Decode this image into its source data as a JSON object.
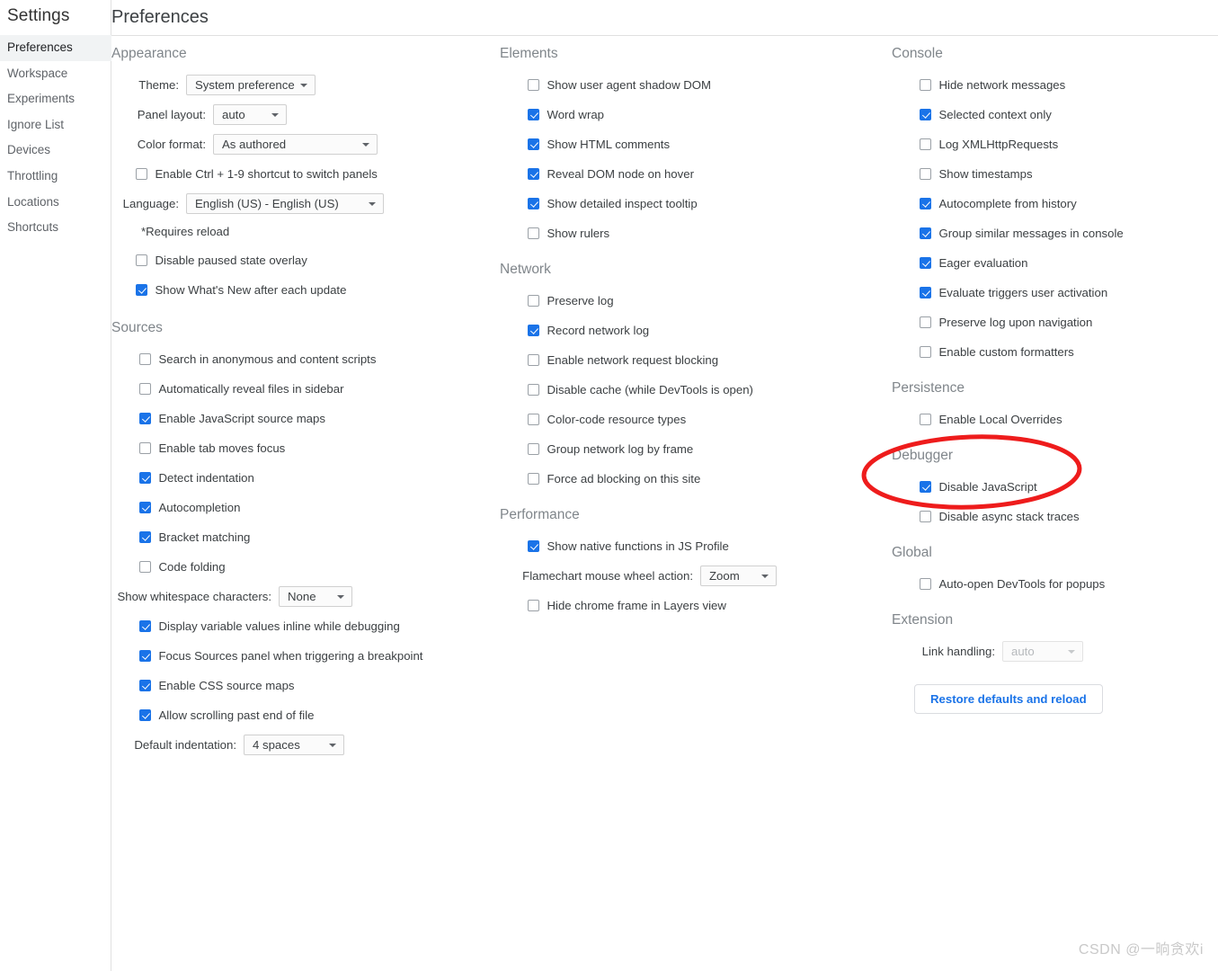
{
  "sidebar": {
    "title": "Settings",
    "items": [
      {
        "label": "Preferences",
        "selected": true
      },
      {
        "label": "Workspace",
        "selected": false
      },
      {
        "label": "Experiments",
        "selected": false
      },
      {
        "label": "Ignore List",
        "selected": false
      },
      {
        "label": "Devices",
        "selected": false
      },
      {
        "label": "Throttling",
        "selected": false
      },
      {
        "label": "Locations",
        "selected": false
      },
      {
        "label": "Shortcuts",
        "selected": false
      }
    ]
  },
  "header": {
    "title": "Preferences"
  },
  "sections": {
    "appearance": {
      "title": "Appearance",
      "theme_label": "Theme:",
      "theme_value": "System preference",
      "panel_layout_label": "Panel layout:",
      "panel_layout_value": "auto",
      "color_format_label": "Color format:",
      "color_format_value": "As authored",
      "ctrl_shortcut_label": "Enable Ctrl + 1-9 shortcut to switch panels",
      "ctrl_shortcut_checked": false,
      "language_label": "Language:",
      "language_value": "English (US) - English (US)",
      "requires_reload_note": "*Requires reload",
      "disable_paused_overlay_label": "Disable paused state overlay",
      "disable_paused_overlay_checked": false,
      "whats_new_label": "Show What's New after each update",
      "whats_new_checked": true
    },
    "sources": {
      "title": "Sources",
      "items": [
        {
          "label": "Search in anonymous and content scripts",
          "checked": false
        },
        {
          "label": "Automatically reveal files in sidebar",
          "checked": false
        },
        {
          "label": "Enable JavaScript source maps",
          "checked": true
        },
        {
          "label": "Enable tab moves focus",
          "checked": false
        },
        {
          "label": "Detect indentation",
          "checked": true
        },
        {
          "label": "Autocompletion",
          "checked": true
        },
        {
          "label": "Bracket matching",
          "checked": true
        },
        {
          "label": "Code folding",
          "checked": false
        }
      ],
      "whitespace_label": "Show whitespace characters:",
      "whitespace_value": "None",
      "items2": [
        {
          "label": "Display variable values inline while debugging",
          "checked": true
        },
        {
          "label": "Focus Sources panel when triggering a breakpoint",
          "checked": true
        },
        {
          "label": "Enable CSS source maps",
          "checked": true
        },
        {
          "label": "Allow scrolling past end of file",
          "checked": true
        }
      ],
      "indentation_label": "Default indentation:",
      "indentation_value": "4 spaces"
    },
    "elements": {
      "title": "Elements",
      "items": [
        {
          "label": "Show user agent shadow DOM",
          "checked": false
        },
        {
          "label": "Word wrap",
          "checked": true
        },
        {
          "label": "Show HTML comments",
          "checked": true
        },
        {
          "label": "Reveal DOM node on hover",
          "checked": true
        },
        {
          "label": "Show detailed inspect tooltip",
          "checked": true
        },
        {
          "label": "Show rulers",
          "checked": false
        }
      ]
    },
    "network": {
      "title": "Network",
      "items": [
        {
          "label": "Preserve log",
          "checked": false
        },
        {
          "label": "Record network log",
          "checked": true
        },
        {
          "label": "Enable network request blocking",
          "checked": false
        },
        {
          "label": "Disable cache (while DevTools is open)",
          "checked": false
        },
        {
          "label": "Color-code resource types",
          "checked": false
        },
        {
          "label": "Group network log by frame",
          "checked": false
        },
        {
          "label": "Force ad blocking on this site",
          "checked": false
        }
      ]
    },
    "performance": {
      "title": "Performance",
      "native_functions_label": "Show native functions in JS Profile",
      "native_functions_checked": true,
      "flamechart_label": "Flamechart mouse wheel action:",
      "flamechart_value": "Zoom",
      "hide_chrome_frame_label": "Hide chrome frame in Layers view",
      "hide_chrome_frame_checked": false
    },
    "console": {
      "title": "Console",
      "items": [
        {
          "label": "Hide network messages",
          "checked": false
        },
        {
          "label": "Selected context only",
          "checked": true
        },
        {
          "label": "Log XMLHttpRequests",
          "checked": false
        },
        {
          "label": "Show timestamps",
          "checked": false
        },
        {
          "label": "Autocomplete from history",
          "checked": true
        },
        {
          "label": "Group similar messages in console",
          "checked": true
        },
        {
          "label": "Eager evaluation",
          "checked": true
        },
        {
          "label": "Evaluate triggers user activation",
          "checked": true
        },
        {
          "label": "Preserve log upon navigation",
          "checked": false
        },
        {
          "label": "Enable custom formatters",
          "checked": false
        }
      ]
    },
    "persistence": {
      "title": "Persistence",
      "items": [
        {
          "label": "Enable Local Overrides",
          "checked": false
        }
      ]
    },
    "debugger": {
      "title": "Debugger",
      "items": [
        {
          "label": "Disable JavaScript",
          "checked": true
        },
        {
          "label": "Disable async stack traces",
          "checked": false
        }
      ]
    },
    "global": {
      "title": "Global",
      "items": [
        {
          "label": "Auto-open DevTools for popups",
          "checked": false
        }
      ]
    },
    "extension": {
      "title": "Extension",
      "link_handling_label": "Link handling:",
      "link_handling_value": "auto",
      "link_handling_disabled": true,
      "restore_button_label": "Restore defaults and reload"
    }
  },
  "annotation": {
    "shape": "ellipse",
    "color": "#ee1c1c",
    "stroke_width": 5
  },
  "watermark": {
    "text": "CSDN @一晌贪欢i"
  }
}
